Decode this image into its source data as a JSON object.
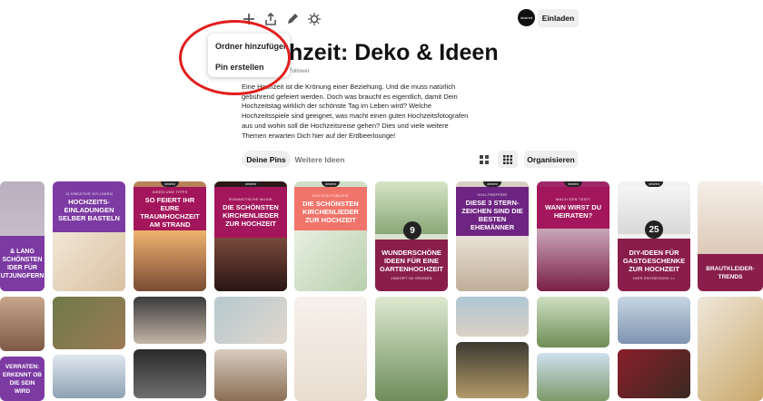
{
  "toolbar": {
    "icons": [
      "plus-icon",
      "share-icon",
      "pencil-icon",
      "magic-icon"
    ]
  },
  "menu": {
    "items": [
      "Ordner hinzufügen",
      "Pin erstellen"
    ]
  },
  "board": {
    "title": "hzeit: Deko & Ideen",
    "followers": "Follower",
    "description": "Eine Hochzeit ist die Krönung einer Beziehung. Und die muss natürlich gebührend gefeiert werden. Doch was braucht es eigentlich, damit Dein Hochzeitstag wirklich der schönste Tag im Leben wird? Welche Hochzeitsspiele sind geeignet, was macht einen guten Hochzeitsfotografen aus und wohin soll die Hochzeitsreise gehen? Dies und viele weitere Themen erwarten Dich hier auf der Erdbeerlounge!"
  },
  "header": {
    "avatar_text": "desired",
    "invite_label": "Einladen"
  },
  "tabs": [
    "Deine Pins",
    "Weitere Ideen"
  ],
  "organize_label": "Organisieren",
  "brand": "desired",
  "pins_row1": [
    {
      "kicker": "",
      "headline": "& LANG SCHÖNSTEN IDER FÜR UTJUNGFERN",
      "number": ""
    },
    {
      "kicker": "11 KREATIVE DIY-IDEEN",
      "headline": "HOCHZEITS-EINLADUNGEN SELBER BASTELN",
      "number": ""
    },
    {
      "kicker": "IDEEN UND TIPPS",
      "headline": "SO FEIERT IHR EURE TRAUMHOCHZEIT AM STRAND",
      "number": ""
    },
    {
      "kicker": "ROMANTISCHE MUSIK",
      "headline": "DIE SCHÖNSTEN KIRCHENLIEDER ZUR HOCHZEIT",
      "number": ""
    },
    {
      "kicker": "HOCHZEITSMUSIK",
      "headline": "DIE SCHÖNSTEN KIRCHENLIEDER ZUR HOCHZEIT",
      "number": ""
    },
    {
      "kicker": "",
      "headline": "WUNDERSCHÖNE IDEEN FÜR EINE GARTENHOCHZEIT",
      "number": "9",
      "footer": "JAWORT IM GRÜNEN"
    },
    {
      "kicker": "VOLLTREFFER!",
      "headline": "DIESE 3 STERN-ZEICHEN SIND DIE BESTEN EHEMÄNNER",
      "number": ""
    },
    {
      "kicker": "MACH DEN TEST!",
      "headline": "WANN WIRST DU HEIRATEN?",
      "number": ""
    },
    {
      "kicker": "",
      "headline": "DIY-IDEEN FÜR GASTGESCHENKE ZUR HOCHZEIT",
      "number": "25",
      "footer": "HIER ENTDECKEN >>"
    },
    {
      "kicker": "",
      "headline": "BRAUTKLEIDER-TRENDS",
      "number": ""
    }
  ],
  "pins_row2": [
    {
      "headline": "VERRATEN: ERKENNT OB DIE SEIN WIRD"
    }
  ],
  "colors": {
    "purple": "#7c3aa3",
    "magenta": "#a3165b",
    "coral": "#f1746a",
    "maroon": "#8a1e4a",
    "annotation_red": "#e11d1d"
  }
}
